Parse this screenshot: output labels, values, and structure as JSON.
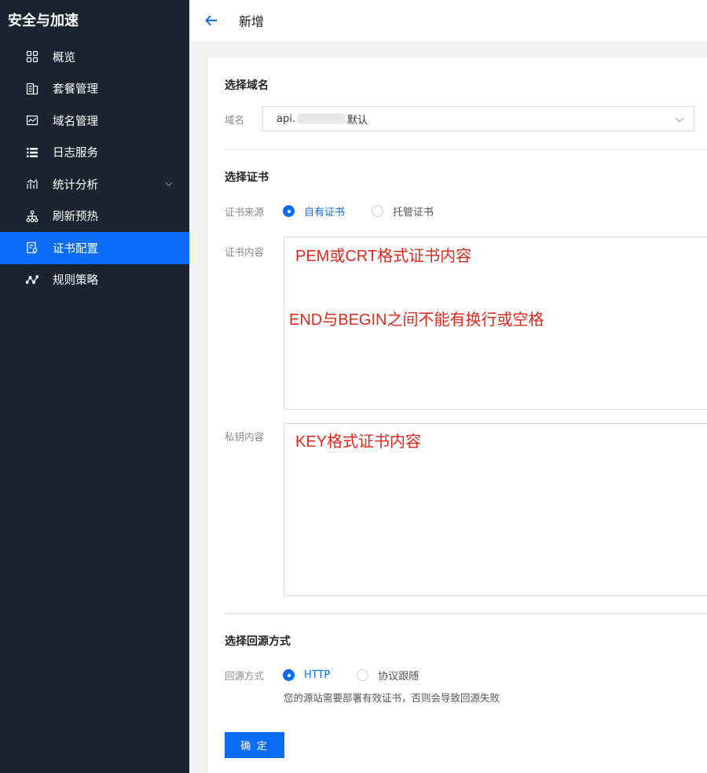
{
  "sidebar": {
    "title": "安全与加速",
    "items": [
      {
        "label": "概览",
        "icon": "grid-icon"
      },
      {
        "label": "套餐管理",
        "icon": "package-icon"
      },
      {
        "label": "域名管理",
        "icon": "domain-icon"
      },
      {
        "label": "日志服务",
        "icon": "list-icon"
      },
      {
        "label": "统计分析",
        "icon": "chart-icon"
      },
      {
        "label": "刷新预热",
        "icon": "hierarchy-icon"
      },
      {
        "label": "证书配置",
        "icon": "certificate-icon",
        "active": true
      },
      {
        "label": "规则策略",
        "icon": "route-icon"
      }
    ]
  },
  "topbar": {
    "title": "新增"
  },
  "domain_section": {
    "title": "选择域名",
    "field_label": "域名",
    "select_prefix": "api.",
    "select_suffix": "默认"
  },
  "cert_section": {
    "title": "选择证书",
    "source_label": "证书来源",
    "source_options": [
      "自有证书",
      "托管证书"
    ],
    "content_label": "证书内容",
    "content_annotation_1": "PEM或CRT格式证书内容",
    "content_annotation_2": "END与BEGIN之间不能有换行或空格",
    "key_label": "私钥内容",
    "key_annotation": "KEY格式证书内容"
  },
  "origin_section": {
    "title": "选择回源方式",
    "method_label": "回源方式",
    "method_options": [
      "HTTP",
      "协议跟随"
    ],
    "hint": "您的源站需要部署有效证书，否则会导致回源失败"
  },
  "confirm_label": "确 定",
  "colors": {
    "accent": "#0a6cf5",
    "sidebar_bg": "#1b2431",
    "annotation": "#e0281c"
  }
}
